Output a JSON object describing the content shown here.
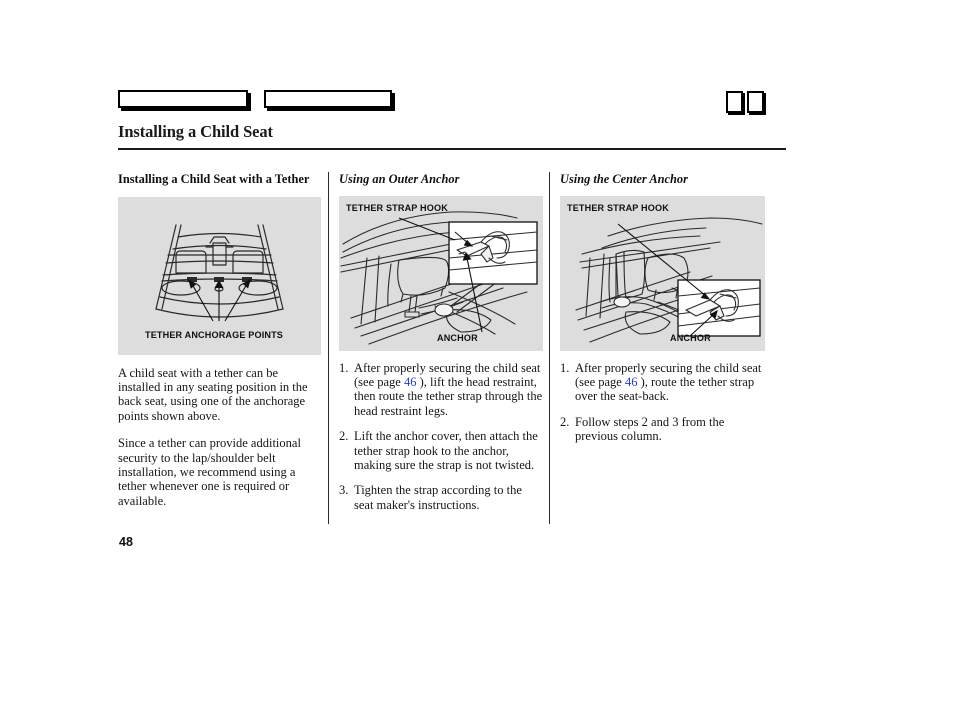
{
  "document": {
    "page_number": "48",
    "title": "Installing a Child Seat"
  },
  "header": {
    "tab_1_label": "",
    "tab_2_label": "",
    "icon_1": "page-marker-icon",
    "icon_2": "page-marker-icon"
  },
  "columns": {
    "left": {
      "heading": "Installing a Child Seat with a Tether",
      "figure": {
        "name": "rear-seat-tether-anchorage-diagram",
        "caption": "TETHER ANCHORAGE POINTS",
        "background_color": "#dddddd"
      },
      "paragraphs": [
        "A child seat with a tether can be installed in any seating position in the back seat, using one of the anchorage points shown above.",
        "Since a tether can provide additional security to the lap/shoulder belt installation, we recommend using a tether whenever one is required or available."
      ]
    },
    "middle": {
      "heading": "Using an Outer Anchor",
      "figure": {
        "name": "outer-anchor-diagram",
        "caption_top": "TETHER STRAP HOOK",
        "caption_bottom": "ANCHOR",
        "background_color": "#dddddd"
      },
      "steps": [
        {
          "num": "1.",
          "text_before": "After properly securing the child seat (see page ",
          "link": "46",
          "text_after": " ), lift the head restraint, then route the tether strap through the head restraint legs."
        },
        {
          "num": "2.",
          "text_before": "Lift the anchor cover, then attach the tether strap hook to the anchor, making sure the strap is not twisted.",
          "link": "",
          "text_after": ""
        },
        {
          "num": "3.",
          "text_before": "Tighten the strap according to the seat maker's instructions.",
          "link": "",
          "text_after": ""
        }
      ]
    },
    "right": {
      "heading": "Using the Center Anchor",
      "figure": {
        "name": "center-anchor-diagram",
        "caption_top": "TETHER STRAP HOOK",
        "caption_bottom": "ANCHOR",
        "background_color": "#dddddd"
      },
      "steps": [
        {
          "num": "1.",
          "text_before": "After properly securing the child seat (see page ",
          "link": "46",
          "text_after": " ), route the tether strap over the seat-back."
        },
        {
          "num": "2.",
          "text_before": "Follow steps 2 and 3 from the previous column.",
          "link": "",
          "text_after": ""
        }
      ]
    }
  },
  "colors": {
    "link": "#2b3bc4",
    "figure_background": "#dddddd",
    "rule": "#1a1a1a",
    "text": "#161616"
  }
}
